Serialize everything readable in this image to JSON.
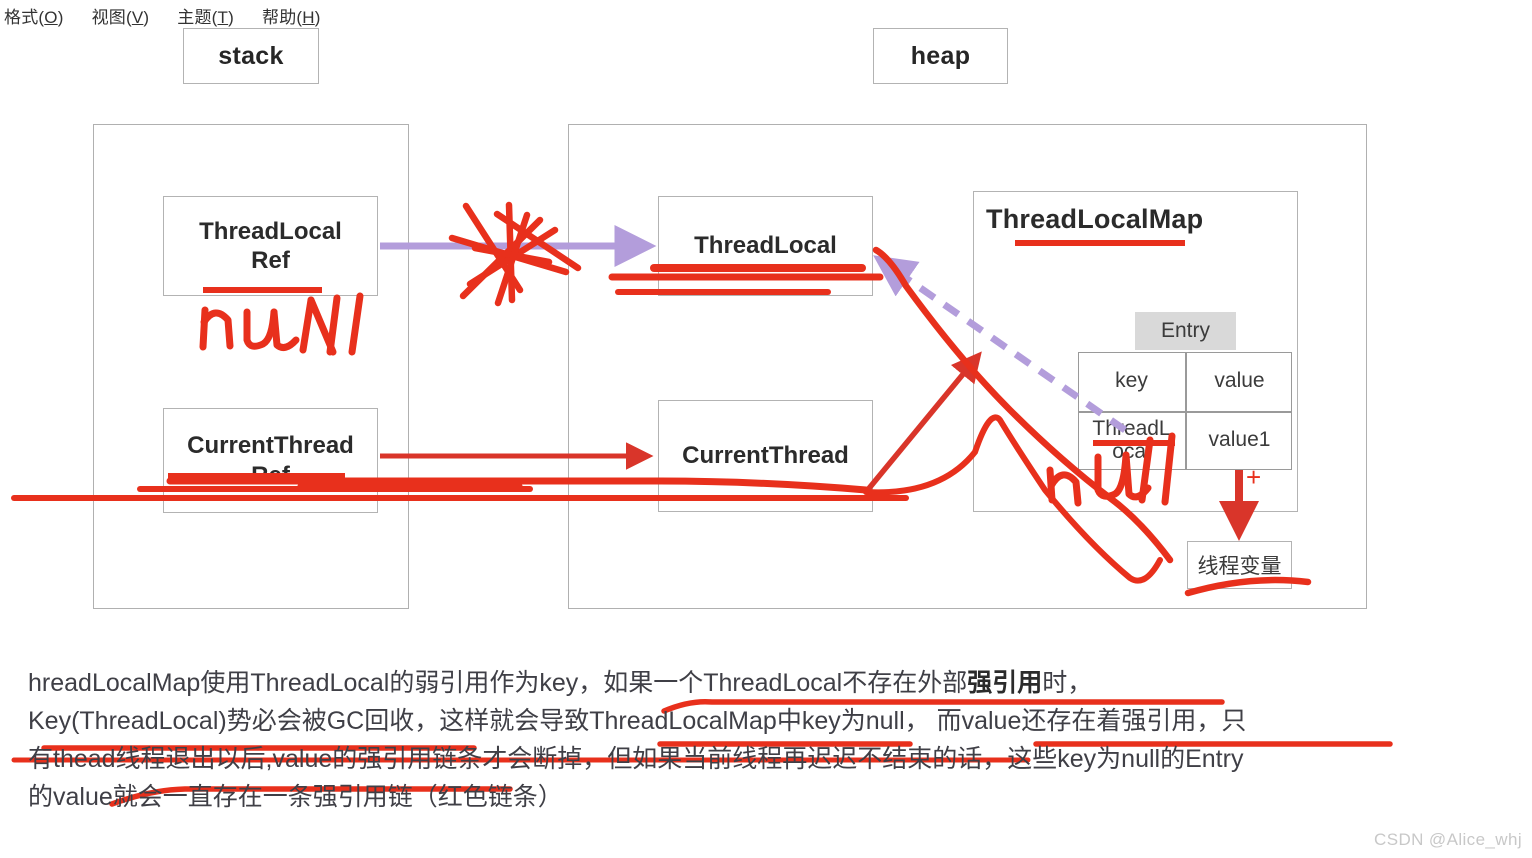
{
  "menu": {
    "items": [
      {
        "label": "格式(O)",
        "key": "O",
        "text": "格式(",
        "close": ")"
      },
      {
        "label": "视图(V)",
        "key": "V",
        "text": "视图(",
        "close": ")"
      },
      {
        "label": "主题(T)",
        "key": "T",
        "text": "主题(",
        "close": ")"
      },
      {
        "label": "帮助(H)",
        "key": "H",
        "text": "帮助(",
        "close": ")"
      }
    ]
  },
  "diagram": {
    "stack_label": "stack",
    "heap_label": "heap",
    "nodes": {
      "threadlocal_ref": "ThreadLocal\nRef",
      "threadlocal_ref_line1": "ThreadLocal",
      "threadlocal_ref_line2": "Ref",
      "currentthread_ref_line1": "CurrentThread",
      "currentthread_ref_line2": "Ref",
      "threadlocal": "ThreadLocal",
      "currentthread": "CurrentThread",
      "threadlocalmap_title": "ThreadLocalMap",
      "entry_label": "Entry",
      "entry_col_key": "key",
      "entry_col_value": "value",
      "entry_row_key": "ThreadLocal",
      "entry_row_key_line1": "ThreadL",
      "entry_row_key_line2": "ocal",
      "entry_row_value": "value1",
      "thread_variable": "线程变量",
      "plus_sign": "+"
    },
    "handwriting": {
      "null_left": "null",
      "null_right": "null",
      "cross_out": "x-scribble"
    },
    "colors": {
      "box_border": "#b3b3b3",
      "text": "#2b2b2b",
      "purple_arrow": "#b39ddb",
      "red_annotation": "#e8301c",
      "entry_header_bg": "#d9d9d9"
    }
  },
  "paragraph": {
    "line1_a": "hreadLocalMap使用ThreadLocal的弱引用作为key，如果一个ThreadLocal不存在外部",
    "line1_bold": "强引用",
    "line1_b": "时，",
    "line2": "Key(ThreadLocal)势必会被GC回收，这样就会导致ThreadLocalMap中key为null， 而value还存在着强引用，只",
    "line3": "有thead线程退出以后,value的强引用链条才会断掉，但如果当前线程再迟迟不结束的话，这些key为null的Entry",
    "line4": "的value就会一直存在一条强引用链（红色链条）"
  },
  "watermark": "CSDN @Alice_whj"
}
